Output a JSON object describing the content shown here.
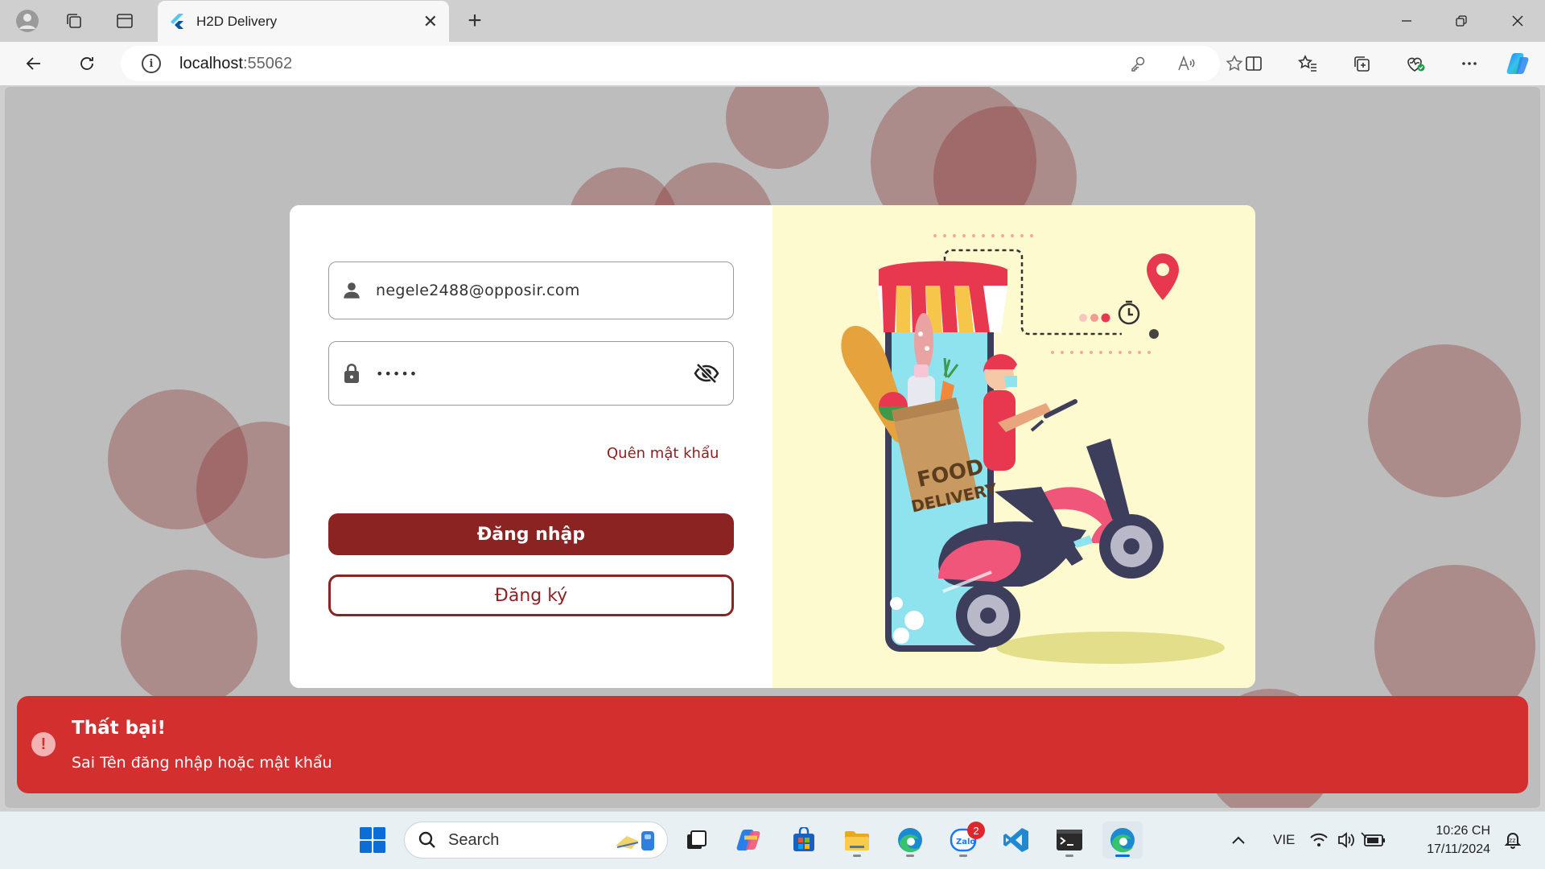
{
  "browser": {
    "tab_title": "H2D Delivery",
    "url_host": "localhost",
    "url_port": ":55062"
  },
  "login": {
    "username_value": "negele2488@opposir.com",
    "password_value": "•••••",
    "forgot_label": "Quên mật khẩu",
    "login_label": "Đăng nhập",
    "register_label": "Đăng ký"
  },
  "illustration": {
    "bag_text_line1": "FOOD",
    "bag_text_line2": "DELIVERY"
  },
  "snackbar": {
    "title": "Thất bại!",
    "message": "Sai Tên đăng nhập hoặc mật khẩu",
    "icon": "!"
  },
  "taskbar": {
    "search_label": "Search",
    "zalo_badge": "2",
    "language": "VIE",
    "time": "10:26 CH",
    "date": "17/11/2024"
  },
  "colors": {
    "brand": "#8b2323",
    "error": "#d32f2f",
    "illustration_bg": "#fdfacf"
  }
}
